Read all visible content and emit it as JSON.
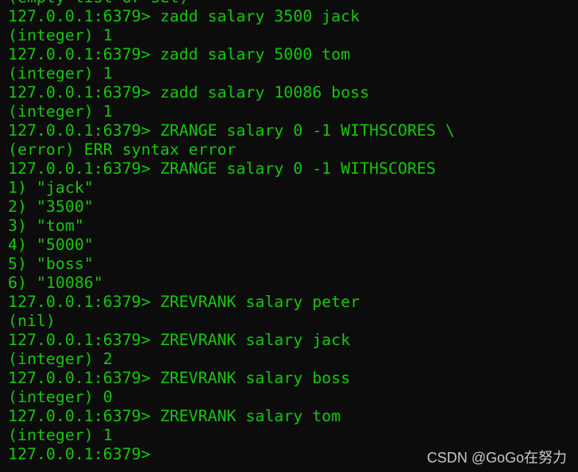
{
  "colors": {
    "background": "#0c0c0c",
    "text": "#16c60c",
    "watermark": "#c8c8c8"
  },
  "lines": [
    "(empty list or set)",
    "127.0.0.1:6379> zadd salary 3500 jack",
    "(integer) 1",
    "127.0.0.1:6379> zadd salary 5000 tom",
    "(integer) 1",
    "127.0.0.1:6379> zadd salary 10086 boss",
    "(integer) 1",
    "127.0.0.1:6379> ZRANGE salary 0 -1 WITHSCORES \\",
    "(error) ERR syntax error",
    "127.0.0.1:6379> ZRANGE salary 0 -1 WITHSCORES",
    "1) \"jack\"",
    "2) \"3500\"",
    "3) \"tom\"",
    "4) \"5000\"",
    "5) \"boss\"",
    "6) \"10086\"",
    "127.0.0.1:6379> ZREVRANK salary peter",
    "(nil)",
    "127.0.0.1:6379> ZREVRANK salary jack",
    "(integer) 2",
    "127.0.0.1:6379> ZREVRANK salary boss",
    "(integer) 0",
    "127.0.0.1:6379> ZREVRANK salary tom",
    "(integer) 1",
    "127.0.0.1:6379> "
  ],
  "watermark": "CSDN @GoGo在努力"
}
